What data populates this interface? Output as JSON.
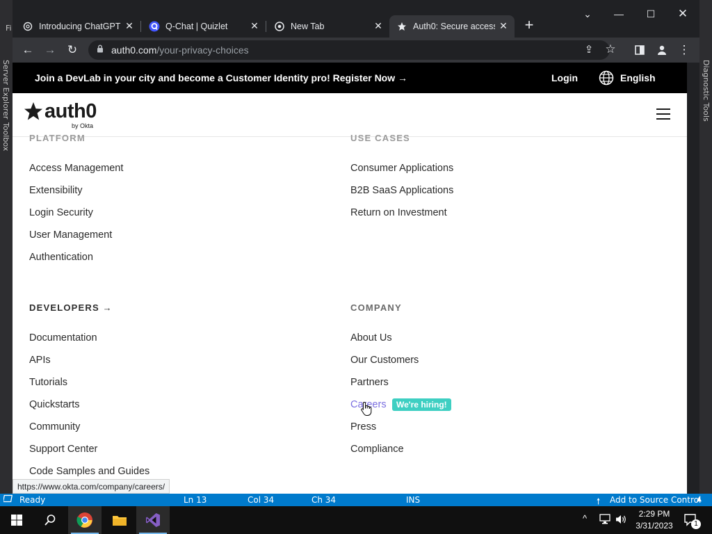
{
  "vs": {
    "left_strip_text_1": "Fi",
    "left_strip_text_2": "Server Explorer",
    "left_strip_text_3": "Toolbox",
    "right_strip_text": "Diagnostic Tools"
  },
  "browser": {
    "tabs": [
      {
        "title": "Introducing ChatGPT",
        "favicon": "openai-icon",
        "active": false
      },
      {
        "title": "Q-Chat | Quizlet",
        "favicon": "quizlet-icon",
        "active": false
      },
      {
        "title": "New Tab",
        "favicon": "chrome-icon",
        "active": false
      },
      {
        "title": "Auth0: Secure access",
        "favicon": "auth0-icon",
        "active": true
      }
    ],
    "url_domain": "auth0.com",
    "url_path": "/your-privacy-choices",
    "status_url": "https://www.okta.com/company/careers/"
  },
  "banner": {
    "message": "Join a DevLab in your city and become a Customer Identity pro!",
    "register": "Register Now →",
    "login": "Login",
    "language": "English"
  },
  "header": {
    "logo_word": "auth0",
    "logo_sub": "by Okta"
  },
  "footer_nav": {
    "platform": {
      "title": "PLATFORM",
      "links": [
        "Access Management",
        "Extensibility",
        "Login Security",
        "User Management",
        "Authentication"
      ]
    },
    "use_cases": {
      "title": "USE CASES",
      "links": [
        "Consumer Applications",
        "B2B SaaS Applications",
        "Return on Investment"
      ]
    },
    "developers": {
      "title": "DEVELOPERS →",
      "links": [
        "Documentation",
        "APIs",
        "Tutorials",
        "Quickstarts",
        "Community",
        "Support Center",
        "Code Samples and Guides"
      ]
    },
    "company": {
      "title": "COMPANY",
      "links": [
        "About Us",
        "Our Customers",
        "Partners",
        "Careers",
        "Press",
        "Compliance"
      ],
      "hiring_badge": "We're hiring!"
    }
  },
  "vs_status": {
    "ready": "Ready",
    "ln": "Ln 13",
    "col": "Col 34",
    "ch": "Ch 34",
    "ins": "INS",
    "source_control": "Add to Source Control"
  },
  "taskbar": {
    "time": "2:29 PM",
    "date": "3/31/2023",
    "notification_count": "1"
  },
  "colors": {
    "accent_hover": "#7a6ee0",
    "badge": "#3ecfc2",
    "vs_blue": "#007acc"
  }
}
